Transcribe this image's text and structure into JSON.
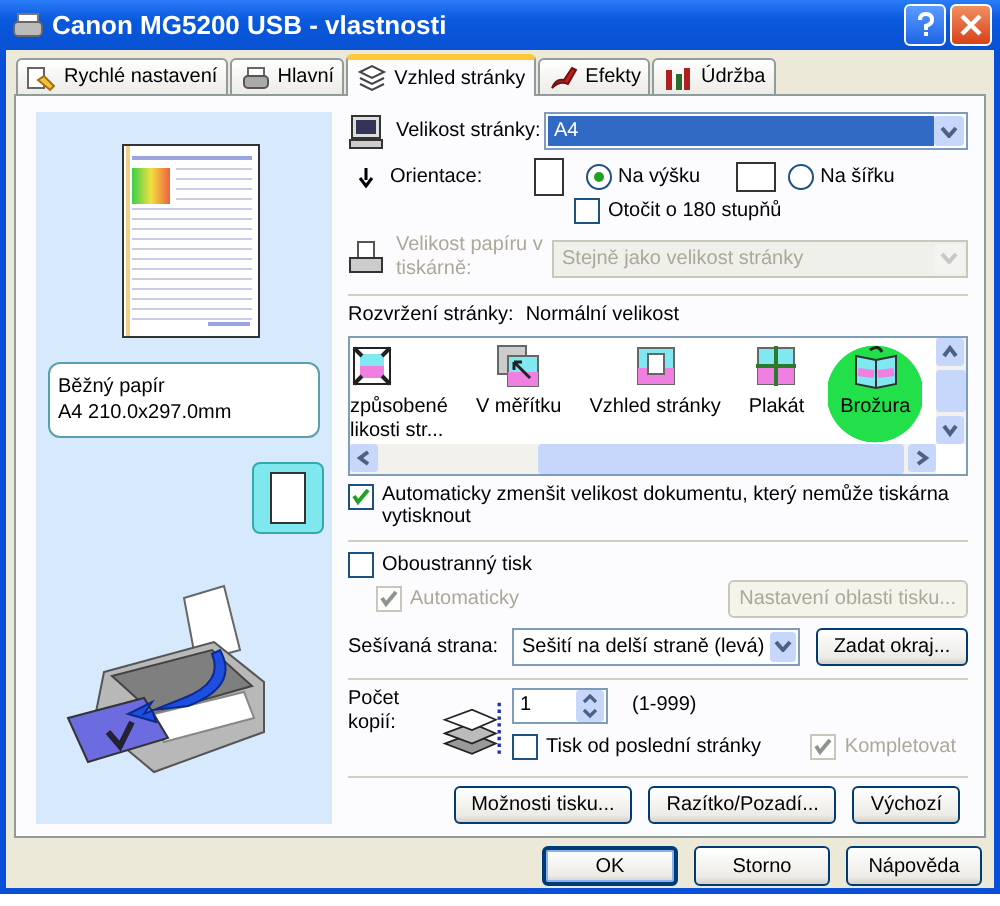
{
  "window": {
    "title": "Canon MG5200 USB - vlastnosti"
  },
  "tabs": [
    {
      "label": "Rychlé nastavení",
      "selected": false
    },
    {
      "label": "Hlavní",
      "selected": false
    },
    {
      "label": "Vzhled stránky",
      "selected": true
    },
    {
      "label": "Efekty",
      "selected": false
    },
    {
      "label": "Údržba",
      "selected": false
    }
  ],
  "preview": {
    "paper_lines": [
      "Běžný papír",
      "A4 210.0x297.0mm"
    ]
  },
  "page_size": {
    "label": "Velikost stránky:",
    "value": "A4"
  },
  "orientation": {
    "label": "Orientace:",
    "options": [
      {
        "label": "Na výšku",
        "selected": true,
        "kind": "portrait"
      },
      {
        "label": "Na šířku",
        "selected": false,
        "kind": "landscape"
      }
    ],
    "rotate": {
      "label": "Otočit o 180 stupňů",
      "checked": false
    }
  },
  "printer_paper_size": {
    "label": "Velikost papíru v tiskárně:",
    "value": "Stejně jako velikost stránky",
    "disabled": true
  },
  "layout": {
    "label": "Rozvržení stránky:",
    "value": "Normální velikost",
    "items": [
      {
        "label": "způsobené\nlikosti str...",
        "kind": "fit",
        "selected": false
      },
      {
        "label": "V měřítku",
        "kind": "scaled",
        "selected": false
      },
      {
        "label": "Vzhled stránky",
        "kind": "pages",
        "selected": false
      },
      {
        "label": "Plakát",
        "kind": "poster",
        "selected": false
      },
      {
        "label": "Brožura",
        "kind": "booklet",
        "selected": true
      }
    ]
  },
  "auto_reduce": {
    "label": "Automaticky zmenšit velikost dokumentu, který nemůže tiskárna vytisknout",
    "checked": true
  },
  "duplex": {
    "label": "Oboustranný tisk",
    "checked": false,
    "automatic": {
      "label": "Automaticky",
      "checked": true,
      "disabled": true
    },
    "area_button": {
      "label": "Nastavení oblasti tisku...",
      "disabled": true
    }
  },
  "binding": {
    "label": "Sešívaná strana:",
    "value": "Sešití na delší straně (levá)",
    "margin_button": "Zadat okraj..."
  },
  "copies": {
    "label": "Počet\nkopií:",
    "value": "1",
    "range": "(1-999)",
    "reverse": {
      "label": "Tisk od poslední stránky",
      "checked": false
    },
    "collate": {
      "label": "Kompletovat",
      "checked": true,
      "disabled": true
    }
  },
  "buttons": [
    "Možnosti tisku...",
    "Razítko/Pozadí...",
    "Výchozí"
  ],
  "dialog_buttons": [
    {
      "label": "OK",
      "default": true
    },
    {
      "label": "Storno",
      "default": false
    },
    {
      "label": "Nápověda",
      "default": false
    }
  ]
}
